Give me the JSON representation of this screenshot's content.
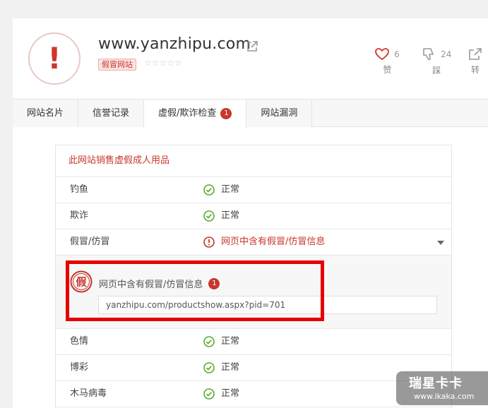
{
  "site": {
    "url": "www.yanzhipu.com",
    "badge": "假冒网站",
    "stars": "☆☆☆☆☆"
  },
  "actions": [
    {
      "count": "6",
      "label": "赞"
    },
    {
      "count": "24",
      "label": "踩"
    },
    {
      "count": "",
      "label": "转"
    }
  ],
  "tabs": [
    {
      "label": "网站名片"
    },
    {
      "label": "信誉记录"
    },
    {
      "label": "虚假/欺诈检查",
      "badge": "1"
    },
    {
      "label": "网站漏洞"
    }
  ],
  "results": {
    "header": "此网站销售虚假成人用品",
    "rows": [
      {
        "name": "钓鱼",
        "status": "正常"
      },
      {
        "name": "欺诈",
        "status": "正常"
      },
      {
        "name": "假冒/仿冒",
        "status": "网页中含有假冒/仿冒信息"
      }
    ],
    "detail": {
      "icon_char": "假",
      "title": "网页中含有假冒/仿冒信息",
      "count": "1",
      "url": "yanzhipu.com/productshow.aspx?pid=701"
    },
    "rows_after": [
      {
        "name": "色情",
        "status": "正常"
      },
      {
        "name": "博彩",
        "status": "正常"
      },
      {
        "name": "木马病毒",
        "status": "正常"
      }
    ]
  },
  "watermark": {
    "title": "瑞星卡卡",
    "url": "www.ikaka.com"
  },
  "colors": {
    "danger": "#c8372c",
    "ok": "#5aaa2f",
    "highlight": "#e60000"
  }
}
